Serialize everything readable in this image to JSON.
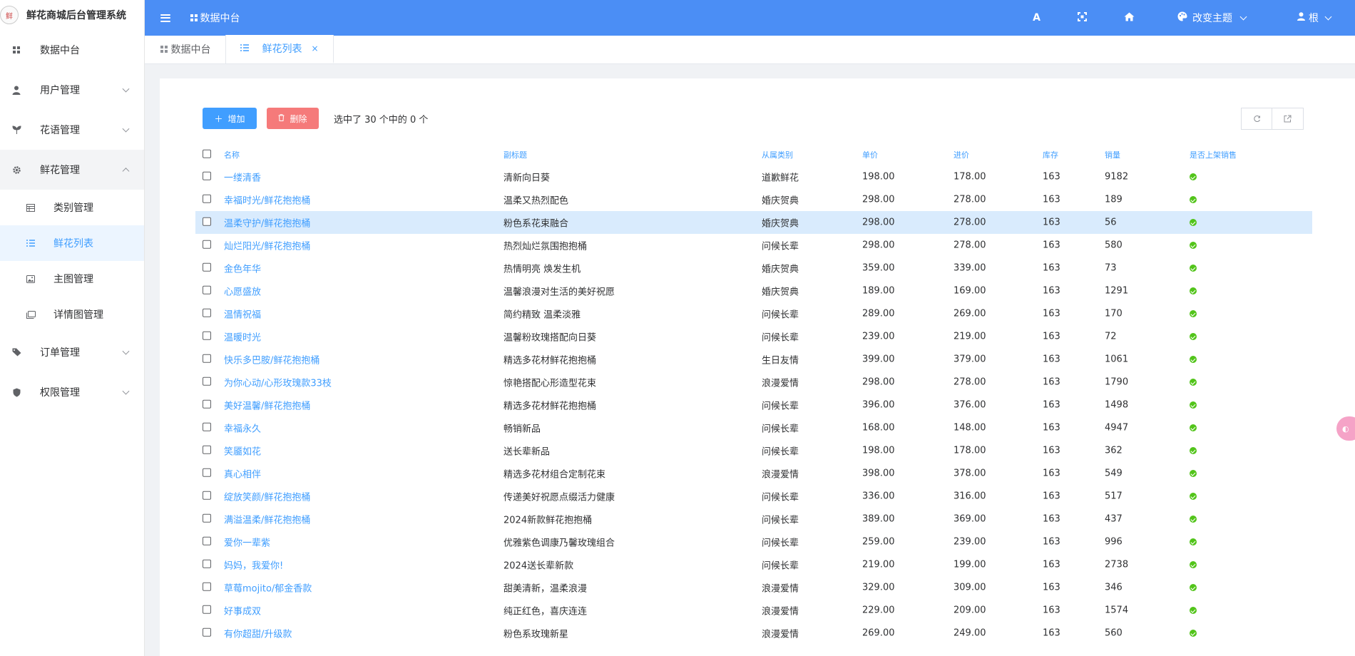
{
  "app": {
    "title": "鲜花商城后台管理系统",
    "logo_text": "鲜"
  },
  "header": {
    "breadcrumb": "数据中台",
    "font_icon": "A",
    "fullscreen_icon": "fullscreen-icon",
    "home_icon": "home-icon",
    "theme_label": "改变主题",
    "user_label": "根"
  },
  "sidebar": {
    "items": [
      {
        "label": "数据中台",
        "icon": "dashboard-icon"
      },
      {
        "label": "用户管理",
        "icon": "user-icon"
      },
      {
        "label": "花语管理",
        "icon": "plant-icon"
      },
      {
        "label": "鲜花管理",
        "icon": "gear-icon"
      },
      {
        "label": "订单管理",
        "icon": "tag-icon"
      },
      {
        "label": "权限管理",
        "icon": "shield-icon"
      }
    ],
    "sub_items": [
      {
        "label": "类别管理",
        "icon": "table-icon"
      },
      {
        "label": "鲜花列表",
        "icon": "list-icon"
      },
      {
        "label": "主图管理",
        "icon": "image-icon"
      },
      {
        "label": "详情图管理",
        "icon": "gallery-icon"
      }
    ]
  },
  "tabs": [
    {
      "label": "数据中台"
    },
    {
      "label": "鲜花列表",
      "close": "×"
    }
  ],
  "toolbar": {
    "add_label": "增加",
    "add_icon": "＋",
    "delete_label": "删除",
    "delete_icon": "🗑",
    "selection_info": "选中了 30 个中的 0 个"
  },
  "table": {
    "columns": [
      "名称",
      "副标题",
      "从属类别",
      "单价",
      "进价",
      "库存",
      "销量",
      "是否上架销售"
    ],
    "rows": [
      {
        "name": "一缕清香",
        "subtitle": "清新向日葵",
        "category": "道歉鲜花",
        "price": "198.00",
        "cost": "178.00",
        "stock": "163",
        "sales": "9182"
      },
      {
        "name": "幸福时光/鲜花抱抱桶",
        "subtitle": "温柔又热烈配色",
        "category": "婚庆贺典",
        "price": "298.00",
        "cost": "278.00",
        "stock": "163",
        "sales": "189"
      },
      {
        "name": "温柔守护/鲜花抱抱桶",
        "subtitle": "粉色系花束融合",
        "category": "婚庆贺典",
        "price": "298.00",
        "cost": "278.00",
        "stock": "163",
        "sales": "56"
      },
      {
        "name": "灿烂阳光/鲜花抱抱桶",
        "subtitle": "热烈灿烂氛围抱抱桶",
        "category": "问候长辈",
        "price": "298.00",
        "cost": "278.00",
        "stock": "163",
        "sales": "580"
      },
      {
        "name": "金色年华",
        "subtitle": "热情明亮 焕发生机",
        "category": "婚庆贺典",
        "price": "359.00",
        "cost": "339.00",
        "stock": "163",
        "sales": "73"
      },
      {
        "name": "心愿盛放",
        "subtitle": "温馨浪漫对生活的美好祝愿",
        "category": "婚庆贺典",
        "price": "189.00",
        "cost": "169.00",
        "stock": "163",
        "sales": "1291"
      },
      {
        "name": "温情祝福",
        "subtitle": "简约精致 温柔淡雅",
        "category": "问候长辈",
        "price": "289.00",
        "cost": "269.00",
        "stock": "163",
        "sales": "170"
      },
      {
        "name": "温暖时光",
        "subtitle": "温馨粉玫瑰搭配向日葵",
        "category": "问候长辈",
        "price": "239.00",
        "cost": "219.00",
        "stock": "163",
        "sales": "72"
      },
      {
        "name": "快乐多巴胺/鲜花抱抱桶",
        "subtitle": "精选多花材鲜花抱抱桶",
        "category": "生日友情",
        "price": "399.00",
        "cost": "379.00",
        "stock": "163",
        "sales": "1061"
      },
      {
        "name": "为你心动/心形玫瑰款33枝",
        "subtitle": "惊艳搭配心形造型花束",
        "category": "浪漫爱情",
        "price": "298.00",
        "cost": "278.00",
        "stock": "163",
        "sales": "1790"
      },
      {
        "name": "美好温馨/鲜花抱抱桶",
        "subtitle": "精选多花材鲜花抱抱桶",
        "category": "问候长辈",
        "price": "396.00",
        "cost": "376.00",
        "stock": "163",
        "sales": "1498"
      },
      {
        "name": "幸福永久",
        "subtitle": "畅销新品",
        "category": "问候长辈",
        "price": "168.00",
        "cost": "148.00",
        "stock": "163",
        "sales": "4947"
      },
      {
        "name": "笑靥如花",
        "subtitle": "送长辈新品",
        "category": "问候长辈",
        "price": "198.00",
        "cost": "178.00",
        "stock": "163",
        "sales": "362"
      },
      {
        "name": "真心相伴",
        "subtitle": "精选多花材组合定制花束",
        "category": "浪漫爱情",
        "price": "398.00",
        "cost": "378.00",
        "stock": "163",
        "sales": "549"
      },
      {
        "name": "绽放笑颜/鲜花抱抱桶",
        "subtitle": "传递美好祝愿点缀活力健康",
        "category": "问候长辈",
        "price": "336.00",
        "cost": "316.00",
        "stock": "163",
        "sales": "517"
      },
      {
        "name": "满溢温柔/鲜花抱抱桶",
        "subtitle": "2024新款鲜花抱抱桶",
        "category": "问候长辈",
        "price": "389.00",
        "cost": "369.00",
        "stock": "163",
        "sales": "437"
      },
      {
        "name": "爱你一辈紫",
        "subtitle": "优雅紫色调康乃馨玫瑰组合",
        "category": "问候长辈",
        "price": "259.00",
        "cost": "239.00",
        "stock": "163",
        "sales": "996"
      },
      {
        "name": "妈妈，我爱你!",
        "subtitle": "2024送长辈新款",
        "category": "问候长辈",
        "price": "219.00",
        "cost": "199.00",
        "stock": "163",
        "sales": "2738"
      },
      {
        "name": "草莓mojito/郁金香款",
        "subtitle": "甜美清新，温柔浪漫",
        "category": "浪漫爱情",
        "price": "329.00",
        "cost": "309.00",
        "stock": "163",
        "sales": "346"
      },
      {
        "name": "好事成双",
        "subtitle": "纯正红色，喜庆连连",
        "category": "浪漫爱情",
        "price": "229.00",
        "cost": "209.00",
        "stock": "163",
        "sales": "1574"
      },
      {
        "name": "有你超甜/升级款",
        "subtitle": "粉色系玫瑰新星",
        "category": "浪漫爱情",
        "price": "269.00",
        "cost": "249.00",
        "stock": "163",
        "sales": "560"
      }
    ]
  },
  "colors": {
    "header_bg": "#4b8ef5",
    "accent": "#409eff",
    "danger": "#f56c6c",
    "success": "#52c41a",
    "highlight_row": "#d9ebfd"
  }
}
